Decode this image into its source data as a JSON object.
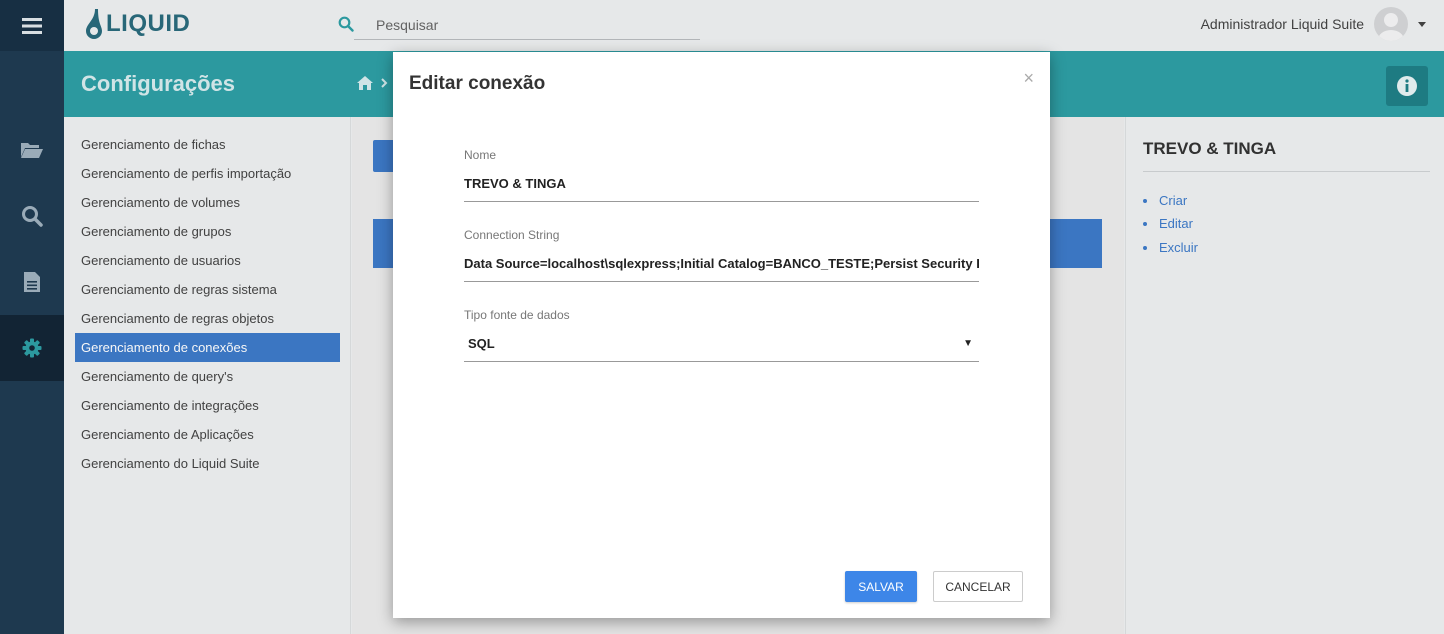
{
  "app": {
    "logo_text": "LIQUID",
    "search_placeholder": "Pesquisar",
    "user_name": "Administrador Liquid Suite"
  },
  "header": {
    "title": "Configurações"
  },
  "menu": {
    "items": [
      "Gerenciamento de fichas",
      "Gerenciamento de perfis importação",
      "Gerenciamento de volumes",
      "Gerenciamento de grupos",
      "Gerenciamento de usuarios",
      "Gerenciamento de regras sistema",
      "Gerenciamento de regras objetos",
      "Gerenciamento de conexões",
      "Gerenciamento de query's",
      "Gerenciamento de integrações",
      "Gerenciamento de Aplicações",
      "Gerenciamento do Liquid Suite"
    ],
    "active_index": 7
  },
  "right_panel": {
    "title": "TREVO & TINGA",
    "actions": [
      "Criar",
      "Editar",
      "Excluir"
    ]
  },
  "modal": {
    "title": "Editar conexão",
    "close": "×",
    "nome_label": "Nome",
    "nome_value": "TREVO & TINGA",
    "conn_label": "Connection String",
    "conn_value": "Data Source=localhost\\sqlexpress;Initial Catalog=BANCO_TESTE;Persist Security Info=",
    "tipo_label": "Tipo fonte de dados",
    "tipo_value": "SQL",
    "save_label": "SALVAR",
    "cancel_label": "CANCELAR"
  },
  "colors": {
    "accent": "#3d7ac9",
    "band": "#2e9ea5",
    "rail": "#1f3b52"
  }
}
